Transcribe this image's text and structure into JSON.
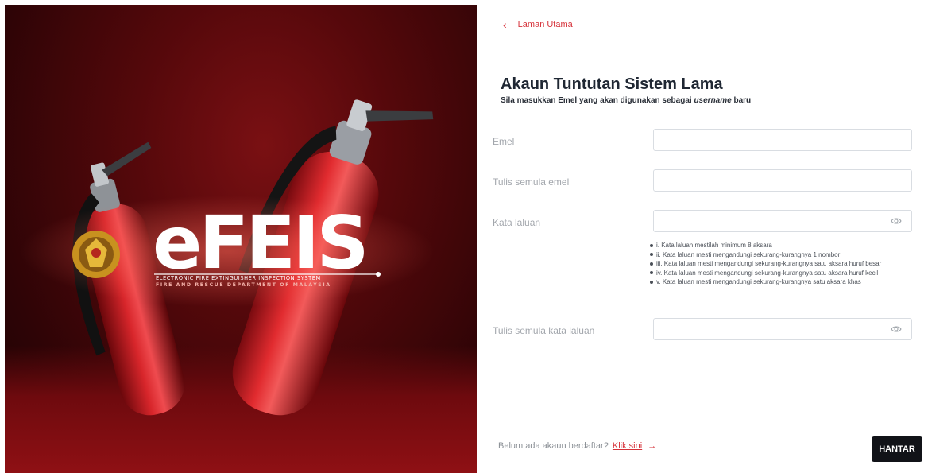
{
  "nav": {
    "back_label": "Laman Utama"
  },
  "header": {
    "title": "Akaun Tuntutan Sistem Lama",
    "subtitle_pre": "Sila masukkan ",
    "subtitle_bold": "Emel",
    "subtitle_mid": " yang akan digunakan sebagai ",
    "subtitle_italic": "username",
    "subtitle_post": " baru"
  },
  "form": {
    "email_label": "Emel",
    "email_value": "",
    "confirm_email_label": "Tulis semula emel",
    "confirm_email_value": "",
    "password_label": "Kata laluan",
    "password_value": "",
    "confirm_password_label": "Tulis semula kata laluan",
    "confirm_password_value": "",
    "password_rules": [
      "i. Kata laluan mestilah minimum 8 aksara",
      "ii. Kata laluan mesti mengandungi sekurang-kurangnya 1 nombor",
      "iii. Kata laluan mesti mengandungi sekurang-kurangnya satu aksara huruf besar",
      "iv. Kata laluan mesti mengandungi sekurang-kurangnya satu aksara huruf kecil",
      "v. Kata laluan mesti mengandungi sekurang-kurangnya satu aksara khas"
    ]
  },
  "footer": {
    "register_text": "Belum ada akaun berdaftar?",
    "register_link": "Klik sini",
    "register_arrow": "→",
    "submit_label": "HANTAR"
  },
  "hero": {
    "logo_text": "eFEIS",
    "tagline_1": "ELECTRONIC FIRE EXTINGUISHER INSPECTION SYSTEM",
    "tagline_2": "FIRE AND RESCUE DEPARTMENT OF MALAYSIA"
  },
  "colors": {
    "accent": "#d6333b",
    "button": "#111318",
    "hero_bg": "#5a080b"
  }
}
